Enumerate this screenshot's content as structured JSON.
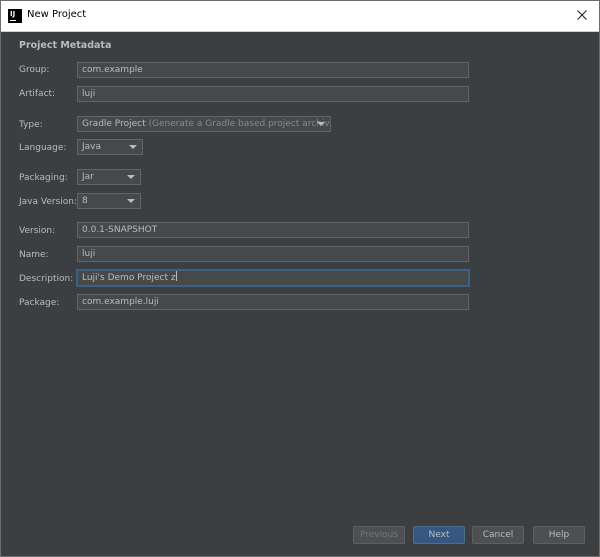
{
  "window": {
    "title": "New Project",
    "app_icon_text": "IJ"
  },
  "section": {
    "title": "Project Metadata"
  },
  "fields": {
    "group": {
      "label": "Group:",
      "value": "com.example"
    },
    "artifact": {
      "label": "Artifact:",
      "value": "luji"
    },
    "type": {
      "label": "Type:",
      "value": "Gradle Project",
      "hint": "(Generate a Gradle based project archive)"
    },
    "language": {
      "label": "Language:",
      "value": "Java"
    },
    "packaging": {
      "label": "Packaging:",
      "value": "Jar"
    },
    "java_version": {
      "label": "Java Version:",
      "value": "8"
    },
    "version": {
      "label": "Version:",
      "value": "0.0.1-SNAPSHOT"
    },
    "name": {
      "label": "Name:",
      "value": "luji"
    },
    "description": {
      "label": "Description:",
      "value": "Luji's Demo Project z"
    },
    "package": {
      "label": "Package:",
      "value": "com.example.luji"
    }
  },
  "buttons": {
    "previous": "Previous",
    "next": "Next",
    "cancel": "Cancel",
    "help": "Help"
  },
  "colors": {
    "background": "#3c3f41",
    "field": "#45494a",
    "text": "#bbbbbb",
    "focus": "#3d6185",
    "default_button": "#365880"
  },
  "icons": {
    "close": "close-icon",
    "dropdown": "chevron-down-icon"
  }
}
